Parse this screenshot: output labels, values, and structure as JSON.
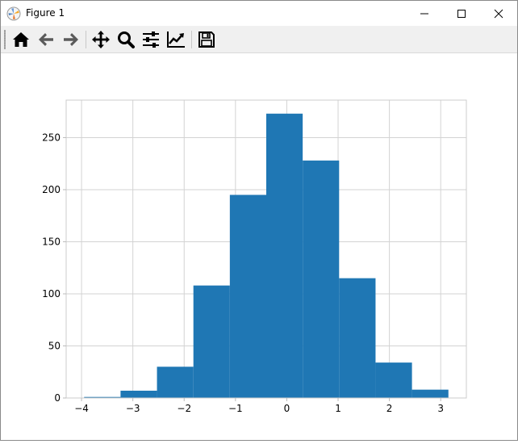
{
  "window": {
    "title": "Figure 1",
    "controls": {
      "minimize": "minimize-icon",
      "maximize": "maximize-icon",
      "close": "close-icon"
    }
  },
  "toolbar": {
    "tools": [
      {
        "name": "home",
        "icon": "home-icon"
      },
      {
        "name": "back",
        "icon": "arrow-left-icon"
      },
      {
        "name": "forward",
        "icon": "arrow-right-icon"
      },
      {
        "name": "pan",
        "icon": "move-icon"
      },
      {
        "name": "zoom",
        "icon": "magnifier-icon"
      },
      {
        "name": "configure-subplots",
        "icon": "sliders-icon"
      },
      {
        "name": "edit-axis",
        "icon": "line-chart-icon"
      },
      {
        "name": "save",
        "icon": "floppy-disk-icon"
      }
    ]
  },
  "chart_data": {
    "type": "bar",
    "style": "histogram",
    "color": "#1f77b4",
    "grid": true,
    "bin_edges": [
      -3.95,
      -3.24,
      -2.53,
      -1.82,
      -1.11,
      -0.4,
      0.31,
      1.02,
      1.73,
      2.44,
      3.15
    ],
    "values": [
      1,
      7,
      30,
      108,
      195,
      273,
      228,
      115,
      34,
      8
    ],
    "xlim": [
      -4.3,
      3.5
    ],
    "ylim": [
      0,
      286
    ],
    "xticks": [
      -4,
      -3,
      -2,
      -1,
      0,
      1,
      2,
      3
    ],
    "xtick_labels": [
      "−4",
      "−3",
      "−2",
      "−1",
      "0",
      "1",
      "2",
      "3"
    ],
    "yticks": [
      0,
      50,
      100,
      150,
      200,
      250
    ],
    "ytick_labels": [
      "0",
      "50",
      "100",
      "150",
      "200",
      "250"
    ]
  }
}
